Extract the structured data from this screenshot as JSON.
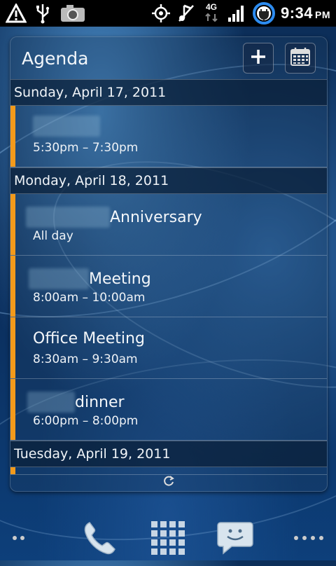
{
  "status_bar": {
    "time": "9:34",
    "ampm": "PM",
    "network": "4G",
    "icons": [
      "warning-icon",
      "usb-icon",
      "camera-icon",
      "gps-icon",
      "mute-icon",
      "4g-icon",
      "signal-icon",
      "battery-charging-icon"
    ]
  },
  "widget": {
    "title": "Agenda",
    "add_button_icon": "plus-icon",
    "calendar_button_icon": "calendar-icon",
    "refresh_icon": "refresh-icon",
    "days": [
      {
        "date": "Sunday, April 17, 2011",
        "events": [
          {
            "title": "",
            "time": "5:30pm – 7:30pm"
          }
        ]
      },
      {
        "date": "Monday, April 18, 2011",
        "events": [
          {
            "title": "Anniversary",
            "time": "All day"
          },
          {
            "title": "Meeting",
            "time": "8:00am – 10:00am"
          },
          {
            "title": "Office Meeting",
            "time": "8:30am – 9:30am"
          },
          {
            "title": "dinner",
            "time": "6:00pm – 8:00pm"
          }
        ]
      },
      {
        "date": "Tuesday, April 19, 2011",
        "events": []
      }
    ]
  },
  "dock": {
    "icons": [
      "left-dots-icon",
      "phone-icon",
      "app-drawer-icon",
      "messaging-icon",
      "right-dots-icon"
    ]
  },
  "colors": {
    "accent": "#f39a1b",
    "status_bar": "#000000"
  }
}
